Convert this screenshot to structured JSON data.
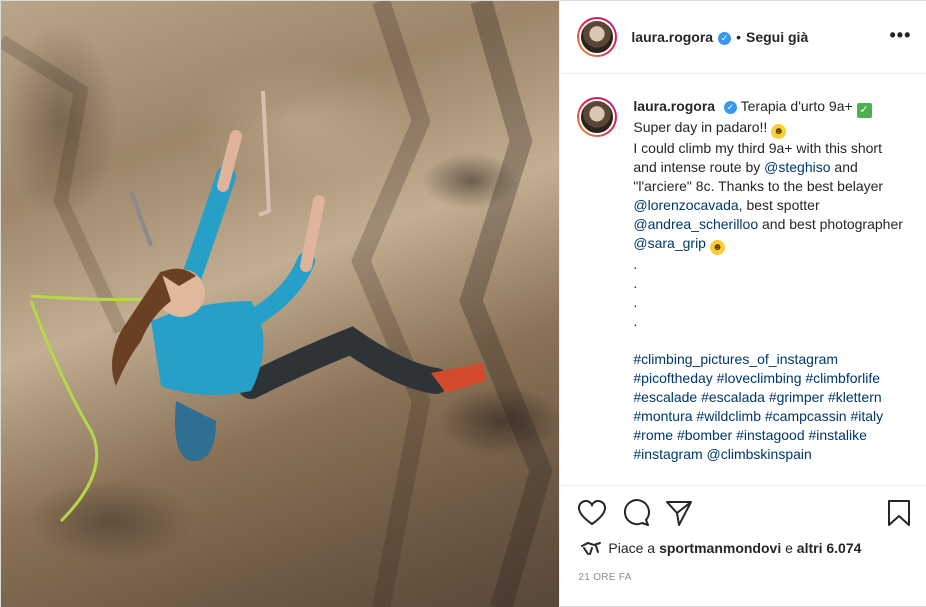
{
  "post": {
    "username": "laura.rogora",
    "verified_icon": "verified-badge-icon",
    "follow_label": "Segui già",
    "separator": "•",
    "more_label": "•••"
  },
  "caption": {
    "username": "laura.rogora",
    "title": "Terapia d'urto 9a+",
    "line2": "Super day in padaro!!",
    "line3a": "I could climb my third 9a+ with this short and intense route by ",
    "mention1": "@steghiso",
    "line4a": " and \"l'arciere\" 8c. Thanks to the best belayer ",
    "mention2": "@lorenzocavada",
    "line5a": ", best spotter ",
    "mention3": "@andrea_scherilloo",
    "line6a": " and best photographer ",
    "mention4": "@sara_grip",
    "dots": [
      ".",
      ".",
      ".",
      "."
    ],
    "hashtags": "#climbing_pictures_of_instagram #picoftheday #loveclimbing #climbforlife #escalade #escalada #grimper #klettern #montura #wildclimb #campcassin #italy #rome #bomber #instagood #instalike #instagram",
    "mention5": "@climbskinspain"
  },
  "actions": {
    "like_icon": "heart-icon",
    "comment_icon": "comment-icon",
    "share_icon": "send-icon",
    "save_icon": "bookmark-icon",
    "likes_prefix": "Piace a ",
    "likes_user": "sportmanmondovi",
    "likes_middle": " e ",
    "likes_count": "altri 6.074",
    "timestamp": "21 ORE FA"
  }
}
